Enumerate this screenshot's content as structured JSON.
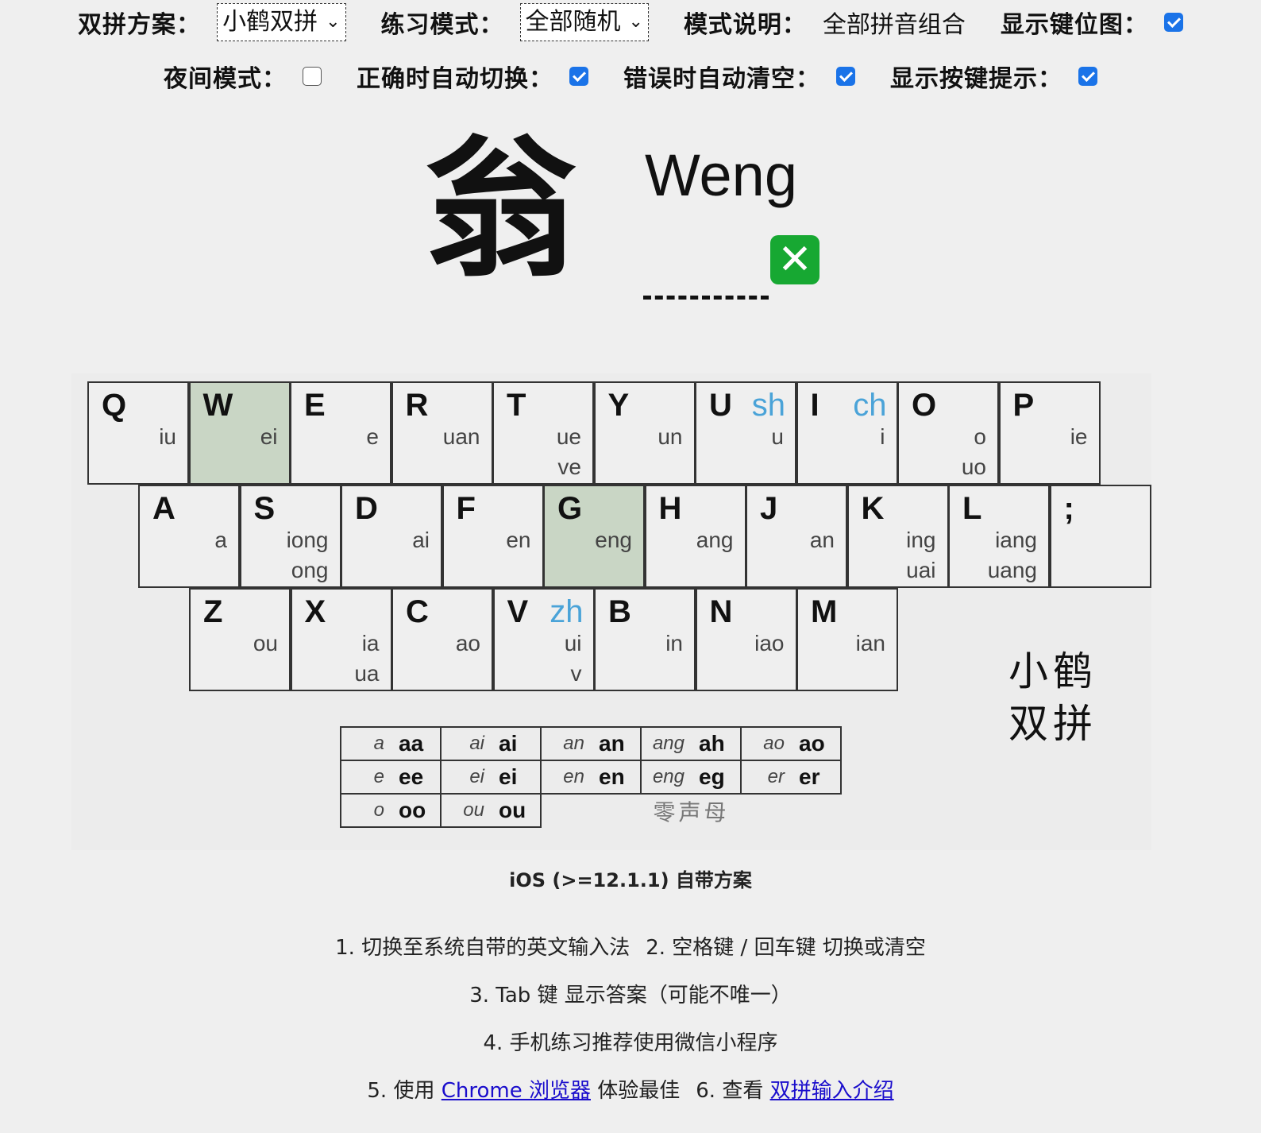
{
  "controls": {
    "scheme_label": "双拼方案：",
    "scheme_value": "小鹤双拼",
    "mode_label": "练习模式：",
    "mode_value": "全部随机",
    "desc_label": "模式说明：",
    "desc_value": "全部拼音组合",
    "show_keymap_label": "显示键位图：",
    "show_keymap": true,
    "night_label": "夜间模式：",
    "night": false,
    "auto_switch_label": "正确时自动切换：",
    "auto_switch": true,
    "auto_clear_label": "错误时自动清空：",
    "auto_clear": true,
    "key_hint_label": "显示按键提示：",
    "key_hint": true
  },
  "practice": {
    "hanzi": "翁",
    "pinyin": "Weng",
    "answer": "",
    "result_icon": "cross-mark-icon"
  },
  "keyboard": {
    "row1": [
      {
        "key": "Q",
        "finals": [
          "iu"
        ]
      },
      {
        "key": "W",
        "finals": [
          "ei"
        ],
        "highlight": true
      },
      {
        "key": "E",
        "finals": [
          "e"
        ]
      },
      {
        "key": "R",
        "finals": [
          "uan"
        ]
      },
      {
        "key": "T",
        "finals": [
          "ue",
          "ve"
        ]
      },
      {
        "key": "Y",
        "finals": [
          "un"
        ]
      },
      {
        "key": "U",
        "initial": "sh",
        "finals": [
          "u"
        ]
      },
      {
        "key": "I",
        "initial": "ch",
        "finals": [
          "i"
        ]
      },
      {
        "key": "O",
        "finals": [
          "o",
          "uo"
        ]
      },
      {
        "key": "P",
        "finals": [
          "ie"
        ]
      }
    ],
    "row2": [
      {
        "key": "A",
        "finals": [
          "a"
        ]
      },
      {
        "key": "S",
        "finals": [
          "iong",
          "ong"
        ]
      },
      {
        "key": "D",
        "finals": [
          "ai"
        ]
      },
      {
        "key": "F",
        "finals": [
          "en"
        ]
      },
      {
        "key": "G",
        "finals": [
          "eng"
        ],
        "highlight": true
      },
      {
        "key": "H",
        "finals": [
          "ang"
        ]
      },
      {
        "key": "J",
        "finals": [
          "an"
        ]
      },
      {
        "key": "K",
        "finals": [
          "ing",
          "uai"
        ]
      },
      {
        "key": "L",
        "finals": [
          "iang",
          "uang"
        ]
      },
      {
        "key": ";",
        "finals": []
      }
    ],
    "row3": [
      {
        "key": "Z",
        "finals": [
          "ou"
        ]
      },
      {
        "key": "X",
        "finals": [
          "ia",
          "ua"
        ]
      },
      {
        "key": "C",
        "finals": [
          "ao"
        ]
      },
      {
        "key": "V",
        "initial": "zh",
        "finals": [
          "ui",
          "v"
        ]
      },
      {
        "key": "B",
        "finals": [
          "in"
        ]
      },
      {
        "key": "N",
        "finals": [
          "iao"
        ]
      },
      {
        "key": "M",
        "finals": [
          "ian"
        ]
      }
    ],
    "brand_line1": "小鹤",
    "brand_line2": "双拼"
  },
  "zero_initial": {
    "rows": [
      [
        [
          "a",
          "aa"
        ],
        [
          "ai",
          "ai"
        ],
        [
          "an",
          "an"
        ],
        [
          "ang",
          "ah"
        ],
        [
          "ao",
          "ao"
        ]
      ],
      [
        [
          "e",
          "ee"
        ],
        [
          "ei",
          "ei"
        ],
        [
          "en",
          "en"
        ],
        [
          "eng",
          "eg"
        ],
        [
          "er",
          "er"
        ]
      ],
      [
        [
          "o",
          "oo"
        ],
        [
          "ou",
          "ou"
        ]
      ]
    ],
    "caption": "零声母"
  },
  "footer": {
    "scheme_caption": "iOS (>=12.1.1) 自带方案",
    "tip1a": "1. 切换至系统自带的英文输入法",
    "tip1b": "2. 空格键 / 回车键 切换或清空",
    "tip3": "3. Tab 键 显示答案（可能不唯一）",
    "tip4": "4. 手机练习推荐使用微信小程序",
    "tip5_prefix": "5. 使用 ",
    "tip5_link": "Chrome 浏览器",
    "tip5_suffix": " 体验最佳",
    "tip6_prefix": "6. 查看 ",
    "tip6_link": "双拼输入介绍"
  },
  "colors": {
    "highlight": "#c9d6c5",
    "initial_hint": "#4aa3d8",
    "checkbox": "#1a73e8",
    "cross": "#17a832",
    "link": "#1a0dcc"
  }
}
